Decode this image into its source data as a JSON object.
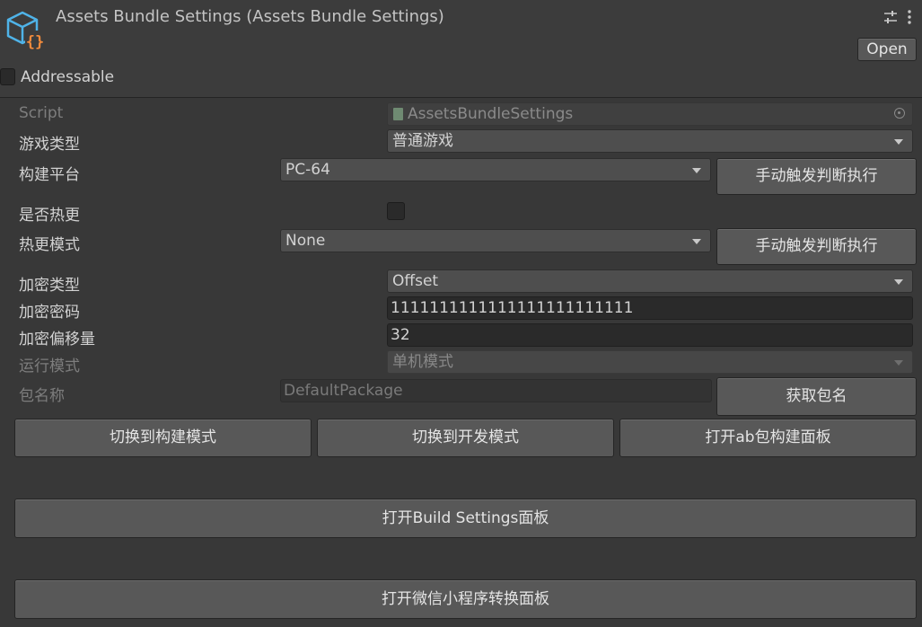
{
  "header": {
    "title": "Assets Bundle Settings (Assets Bundle Settings)",
    "open_label": "Open",
    "addressable_label": "Addressable"
  },
  "script": {
    "label": "Script",
    "value": "AssetsBundleSettings"
  },
  "game_type": {
    "label": "游戏类型",
    "value": "普通游戏"
  },
  "build_platform": {
    "label": "构建平台",
    "value": "PC-64",
    "button": "手动触发判断执行"
  },
  "hot_update": {
    "label": "是否热更"
  },
  "hot_update_mode": {
    "label": "热更模式",
    "value": "None",
    "button": "手动触发判断执行"
  },
  "encrypt_type": {
    "label": "加密类型",
    "value": "Offset"
  },
  "encrypt_password": {
    "label": "加密密码",
    "value": "1111111111111111111111111"
  },
  "encrypt_offset": {
    "label": "加密偏移量",
    "value": "32"
  },
  "run_mode": {
    "label": "运行模式",
    "value": "单机模式"
  },
  "package_name": {
    "label": "包名称",
    "value": "DefaultPackage",
    "button": "获取包名"
  },
  "actions": {
    "switch_build": "切换到构建模式",
    "switch_dev": "切换到开发模式",
    "open_ab": "打开ab包构建面板",
    "open_build_settings": "打开Build Settings面板",
    "open_wechat": "打开微信小程序转换面板"
  },
  "icons": {
    "asset": "cube-braces-icon",
    "settings": "sliders-icon",
    "more": "kebab-menu-icon",
    "script": "script-file-icon",
    "target": "object-picker-icon"
  }
}
